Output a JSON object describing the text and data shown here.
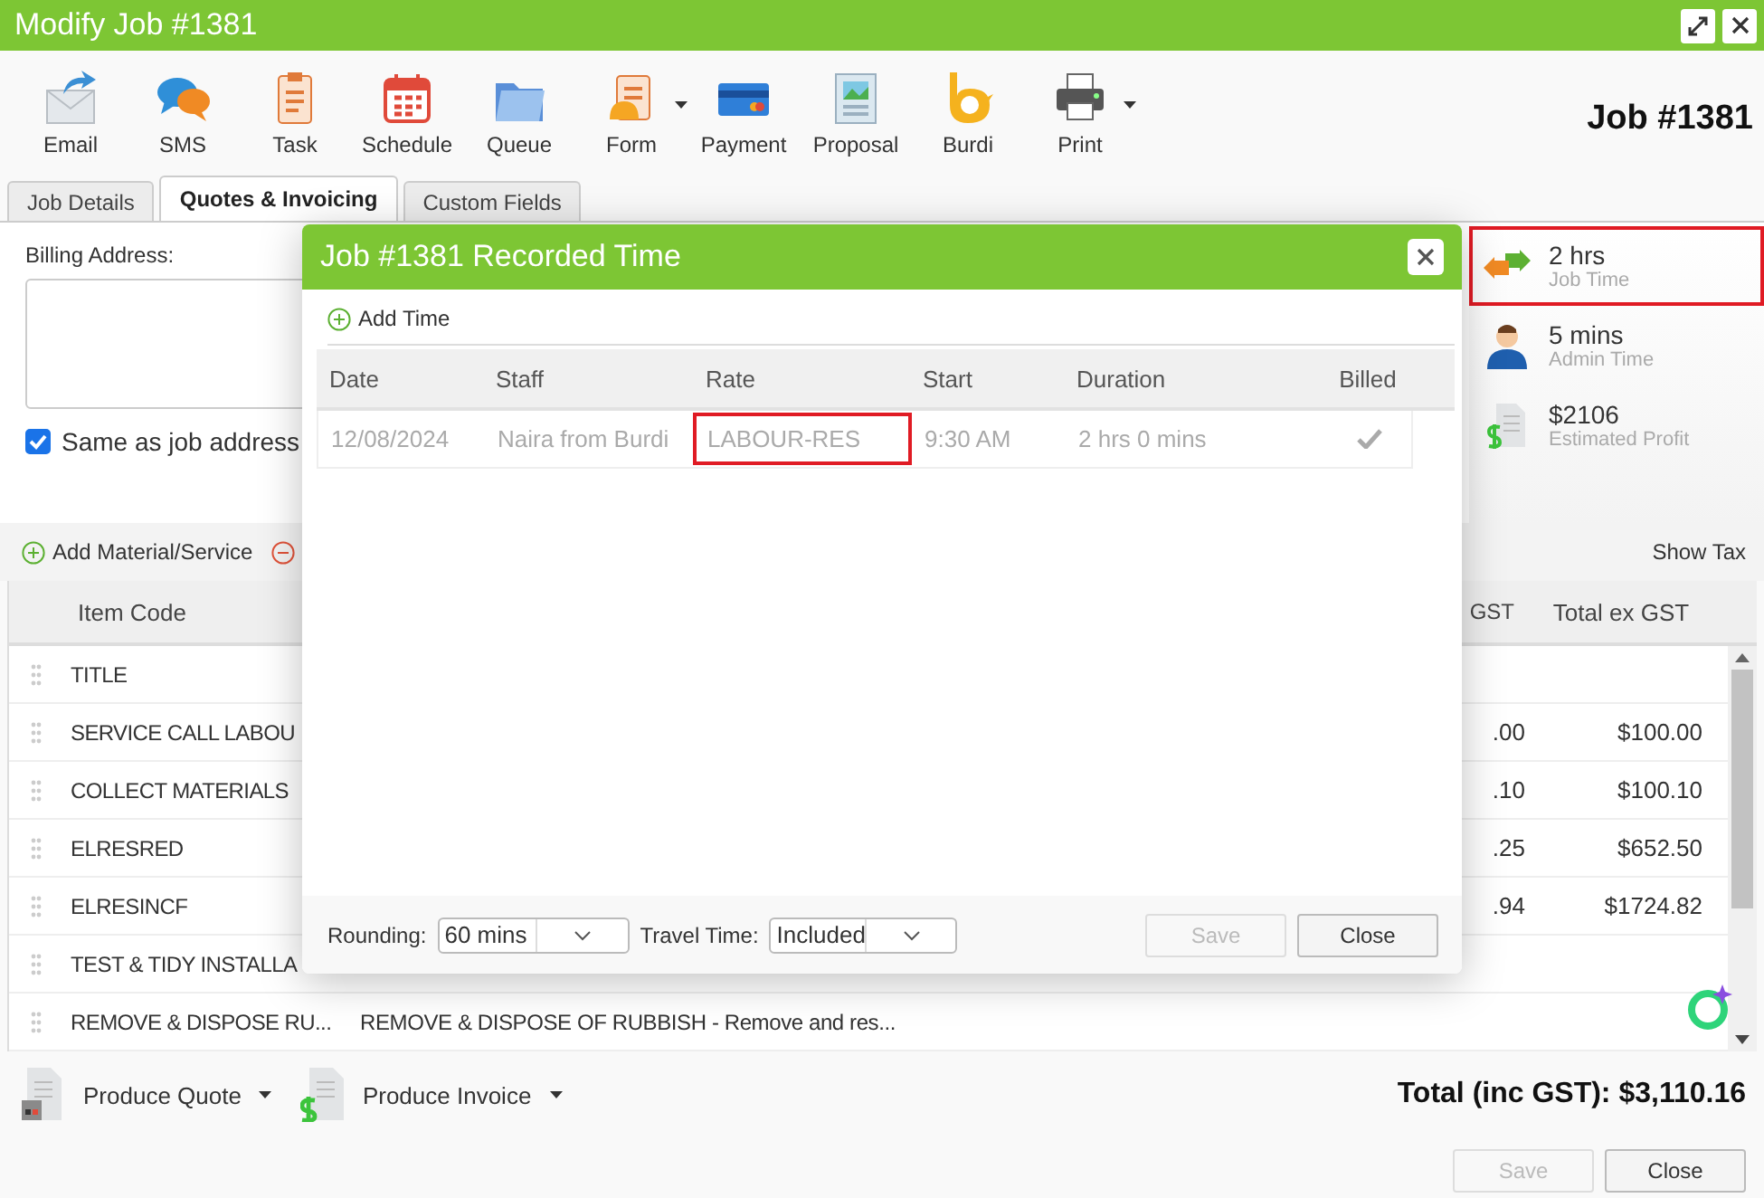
{
  "window": {
    "title": "Modify Job #1381"
  },
  "toolbar": [
    {
      "label": "Email",
      "dropdown": false
    },
    {
      "label": "SMS",
      "dropdown": false
    },
    {
      "label": "Task",
      "dropdown": false
    },
    {
      "label": "Schedule",
      "dropdown": false
    },
    {
      "label": "Queue",
      "dropdown": false
    },
    {
      "label": "Form",
      "dropdown": true
    },
    {
      "label": "Payment",
      "dropdown": false
    },
    {
      "label": "Proposal",
      "dropdown": false
    },
    {
      "label": "Burdi",
      "dropdown": false
    },
    {
      "label": "Print",
      "dropdown": true
    }
  ],
  "job_heading": "Job #1381",
  "tabs": [
    {
      "label": "Job Details",
      "selected": false
    },
    {
      "label": "Quotes & Invoicing",
      "selected": true
    },
    {
      "label": "Custom Fields",
      "selected": false
    }
  ],
  "billing": {
    "label": "Billing Address:",
    "same_as_job_address": {
      "label": "Same as job address",
      "checked": true
    }
  },
  "stats": [
    {
      "value": "2 hrs",
      "label": "Job Time",
      "highlighted": true
    },
    {
      "value": "5 mins",
      "label": "Admin Time",
      "highlighted": false
    },
    {
      "value": "$2106",
      "label": "Estimated Profit",
      "highlighted": false
    }
  ],
  "actions": {
    "add": "Add Material/Service",
    "show_tax": "Show Tax"
  },
  "table": {
    "columns": [
      "Item Code",
      "GST",
      "Total ex GST"
    ],
    "rows": [
      {
        "code": "TITLE"
      },
      {
        "code": "SERVICE CALL LABOU",
        "gst": ".00",
        "total": "$100.00"
      },
      {
        "code": "COLLECT MATERIALS",
        "gst": ".10",
        "total": "$100.10"
      },
      {
        "code": "ELRESRED",
        "gst": ".25",
        "total": "$652.50"
      },
      {
        "code": "ELRESINCF",
        "gst": ".94",
        "total": "$1724.82"
      },
      {
        "code": "TEST & TIDY INSTALLA"
      },
      {
        "code": "REMOVE & DISPOSE RU...",
        "description": "REMOVE & DISPOSE OF RUBBISH - Remove and res..."
      }
    ]
  },
  "footer": {
    "produce": [
      "Produce Quote",
      "Produce Invoice"
    ],
    "total": "Total (inc GST): $3,110.16",
    "buttons": [
      {
        "label": "Save",
        "disabled": true
      },
      {
        "label": "Close",
        "disabled": false
      }
    ]
  },
  "dialog": {
    "title": "Job #1381 Recorded Time",
    "add_time": "Add Time",
    "columns": [
      "Date",
      "Staff",
      "Rate",
      "Start",
      "Duration",
      "Billed"
    ],
    "rows": [
      {
        "date": "12/08/2024",
        "staff": "Naira from Burdi",
        "rate": "LABOUR-RES",
        "rate_highlighted": true,
        "start": "9:30 AM",
        "duration": "2 hrs 0 mins",
        "billed": true
      }
    ],
    "rounding": {
      "label": "Rounding:",
      "value": "60 mins"
    },
    "travel_time": {
      "label": "Travel Time:",
      "value": "Included"
    },
    "buttons": [
      {
        "label": "Save",
        "disabled": true
      },
      {
        "label": "Close",
        "disabled": false
      }
    ]
  }
}
